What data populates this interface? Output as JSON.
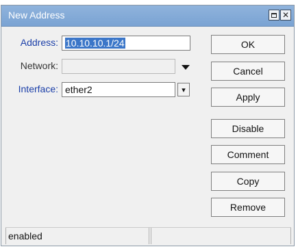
{
  "window": {
    "title": "New Address",
    "maximize_icon": "maximize-icon",
    "close_icon": "close-icon"
  },
  "form": {
    "address": {
      "label": "Address:",
      "value": "10.10.10.1/24"
    },
    "network": {
      "label": "Network:",
      "value": ""
    },
    "interface": {
      "label": "Interface:",
      "value": "ether2"
    }
  },
  "buttons": {
    "ok": "OK",
    "cancel": "Cancel",
    "apply": "Apply",
    "disable": "Disable",
    "comment": "Comment",
    "copy": "Copy",
    "remove": "Remove"
  },
  "status": {
    "left": "enabled",
    "right": ""
  },
  "colors": {
    "titlebar": "#7aa3d3",
    "label_blue": "#1a3ea8",
    "selection": "#3b76c8"
  }
}
